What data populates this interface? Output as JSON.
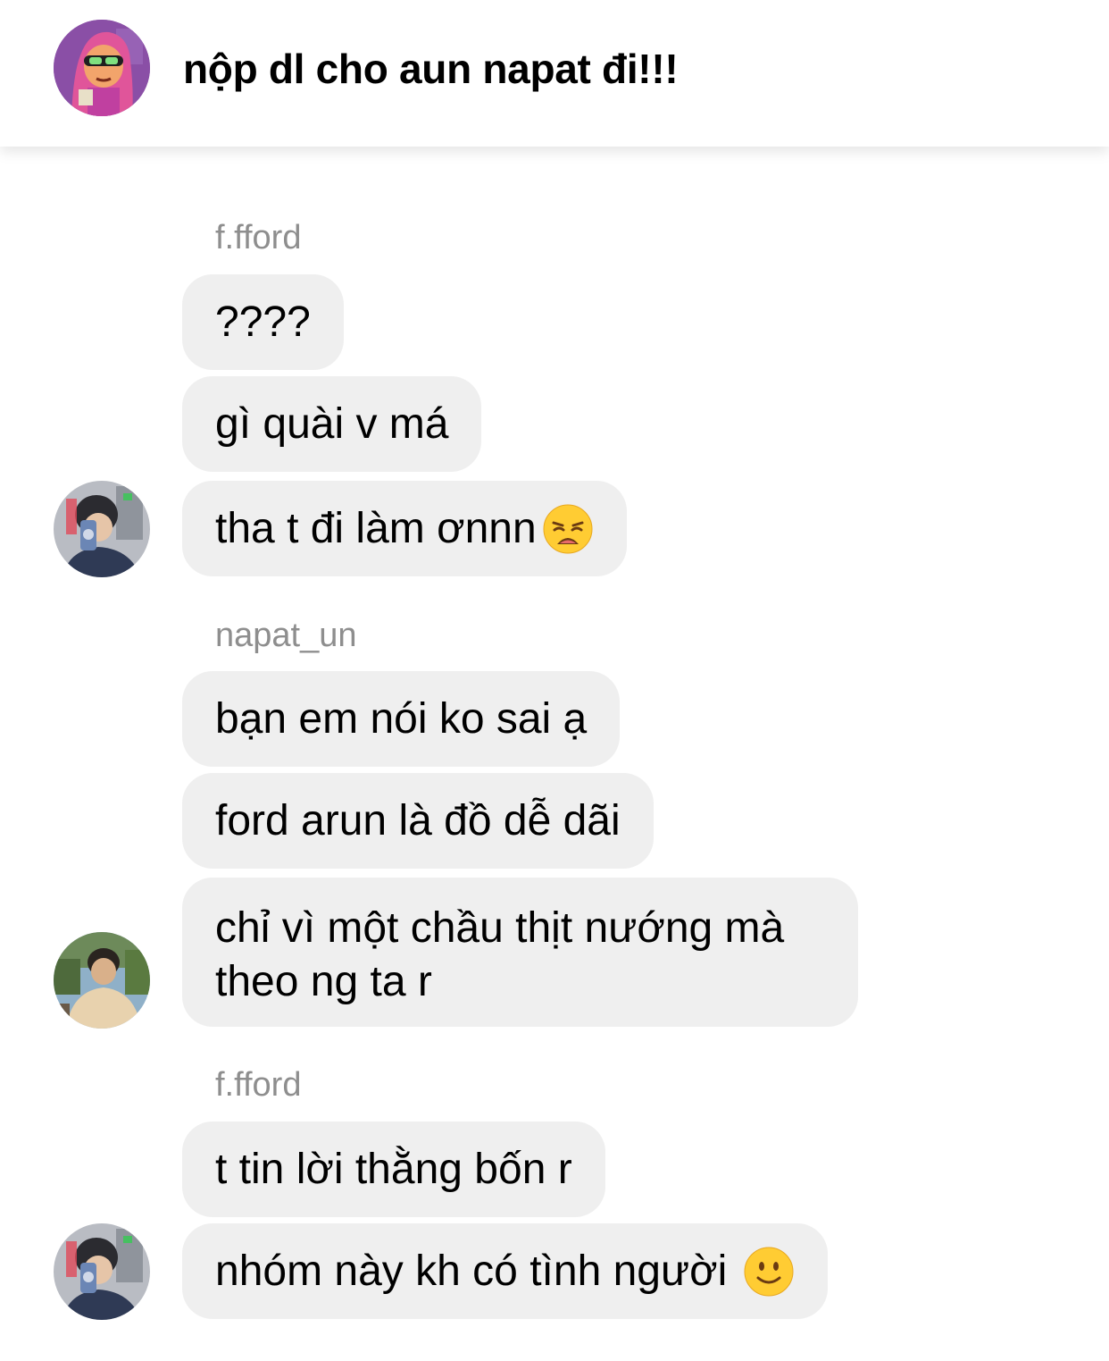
{
  "header": {
    "title": "nộp dl cho aun napat đi!!!"
  },
  "colors": {
    "bubble_bg": "#efefef",
    "sender_text": "#8e8e8e",
    "group_avatar_bg": "#8a4fa6"
  },
  "groups": [
    {
      "sender": "f.fford",
      "messages": [
        "????",
        "gì quài v má",
        "tha t đi làm ơnnn"
      ],
      "last_emoji": "weary-face-emoji",
      "avatar": "mirror-selfie-avatar"
    },
    {
      "sender": "napat_un",
      "messages": [
        "bạn em nói ko sai ạ",
        "ford arun là đồ dễ dãi"
      ],
      "multiline_message": [
        "chỉ vì một chầu thịt nướng mà",
        "theo ng ta r"
      ],
      "avatar": "outdoor-photo-avatar"
    },
    {
      "sender": "f.fford",
      "messages": [
        "t tin lời thằng bốn r",
        "nhóm này kh có tình người"
      ],
      "last_emoji": "slightly-smiling-face-emoji",
      "avatar": "mirror-selfie-avatar"
    }
  ]
}
